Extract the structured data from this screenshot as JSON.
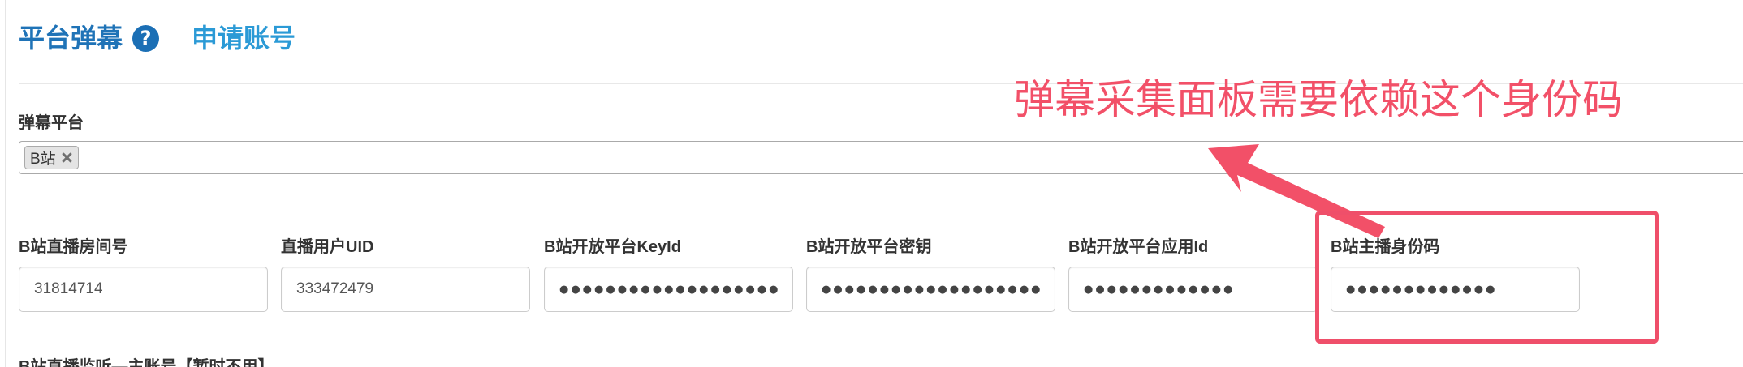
{
  "header": {
    "title": "平台弹幕",
    "help_icon": "question-circle-icon",
    "apply_link": "申请账号"
  },
  "platform": {
    "label": "弹幕平台",
    "selected": [
      {
        "label": "B站",
        "remove_icon": "close-icon"
      }
    ]
  },
  "fields": [
    {
      "label": "B站直播房间号",
      "value": "31814714"
    },
    {
      "label": "直播用户UID",
      "value": "333472479"
    },
    {
      "label": "B站开放平台KeyId",
      "value": "●●●●●●●●●●●●●●●●●●●●●●●●"
    },
    {
      "label": "B站开放平台密钥",
      "value": "●●●●●●●●●●●●●●●●●●●●●●●●"
    },
    {
      "label": "B站开放平台应用Id",
      "value": "●●●●●●●●●●●●●"
    },
    {
      "label": "B站主播身份码",
      "value": "●●●●●●●●●●●●●"
    }
  ],
  "next_section": {
    "label": "B站直播监听—主账号【暂时不用】"
  },
  "annotation": {
    "text": "弹幕采集面板需要依赖这个身份码",
    "arrow_icon": "arrow-icon",
    "highlight_target": "B站主播身份码"
  },
  "colors": {
    "title": "#1f73b7",
    "link": "#2b9ad6",
    "annotation": "#f25068",
    "highlight_box": "#ef4f6a"
  }
}
